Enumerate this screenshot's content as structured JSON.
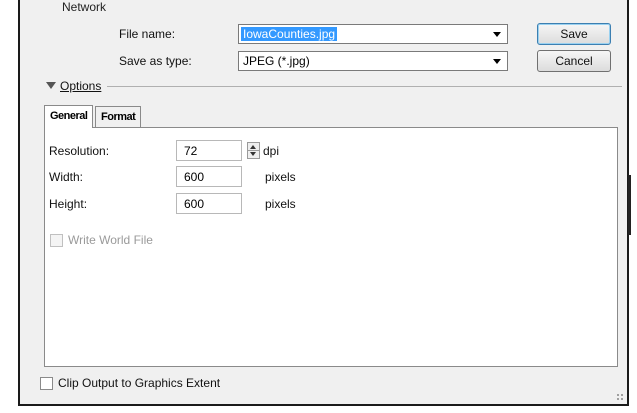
{
  "top": {
    "network_label": "Network",
    "file_name_label": "File name:",
    "file_name_value": "IowaCounties.jpg",
    "save_as_type_label": "Save as type:",
    "save_as_type_value": "JPEG (*.jpg)",
    "save_button": "Save",
    "cancel_button": "Cancel"
  },
  "options": {
    "header": "Options",
    "tabs": [
      {
        "label": "General",
        "active": true
      },
      {
        "label": "Format",
        "active": false
      }
    ],
    "general": {
      "resolution_label": "Resolution:",
      "resolution_value": "72",
      "resolution_unit": "dpi",
      "width_label": "Width:",
      "width_value": "600",
      "width_unit": "pixels",
      "height_label": "Height:",
      "height_value": "600",
      "height_unit": "pixels",
      "world_file_label": "Write World File",
      "world_file_checked": false,
      "world_file_enabled": false
    }
  },
  "bottom": {
    "clip_label": "Clip Output to Graphics Extent",
    "clip_checked": false
  },
  "colors": {
    "window_bg": "#f0f0f0",
    "selection": "#3399ff",
    "panel_bg": "#ffffff"
  }
}
